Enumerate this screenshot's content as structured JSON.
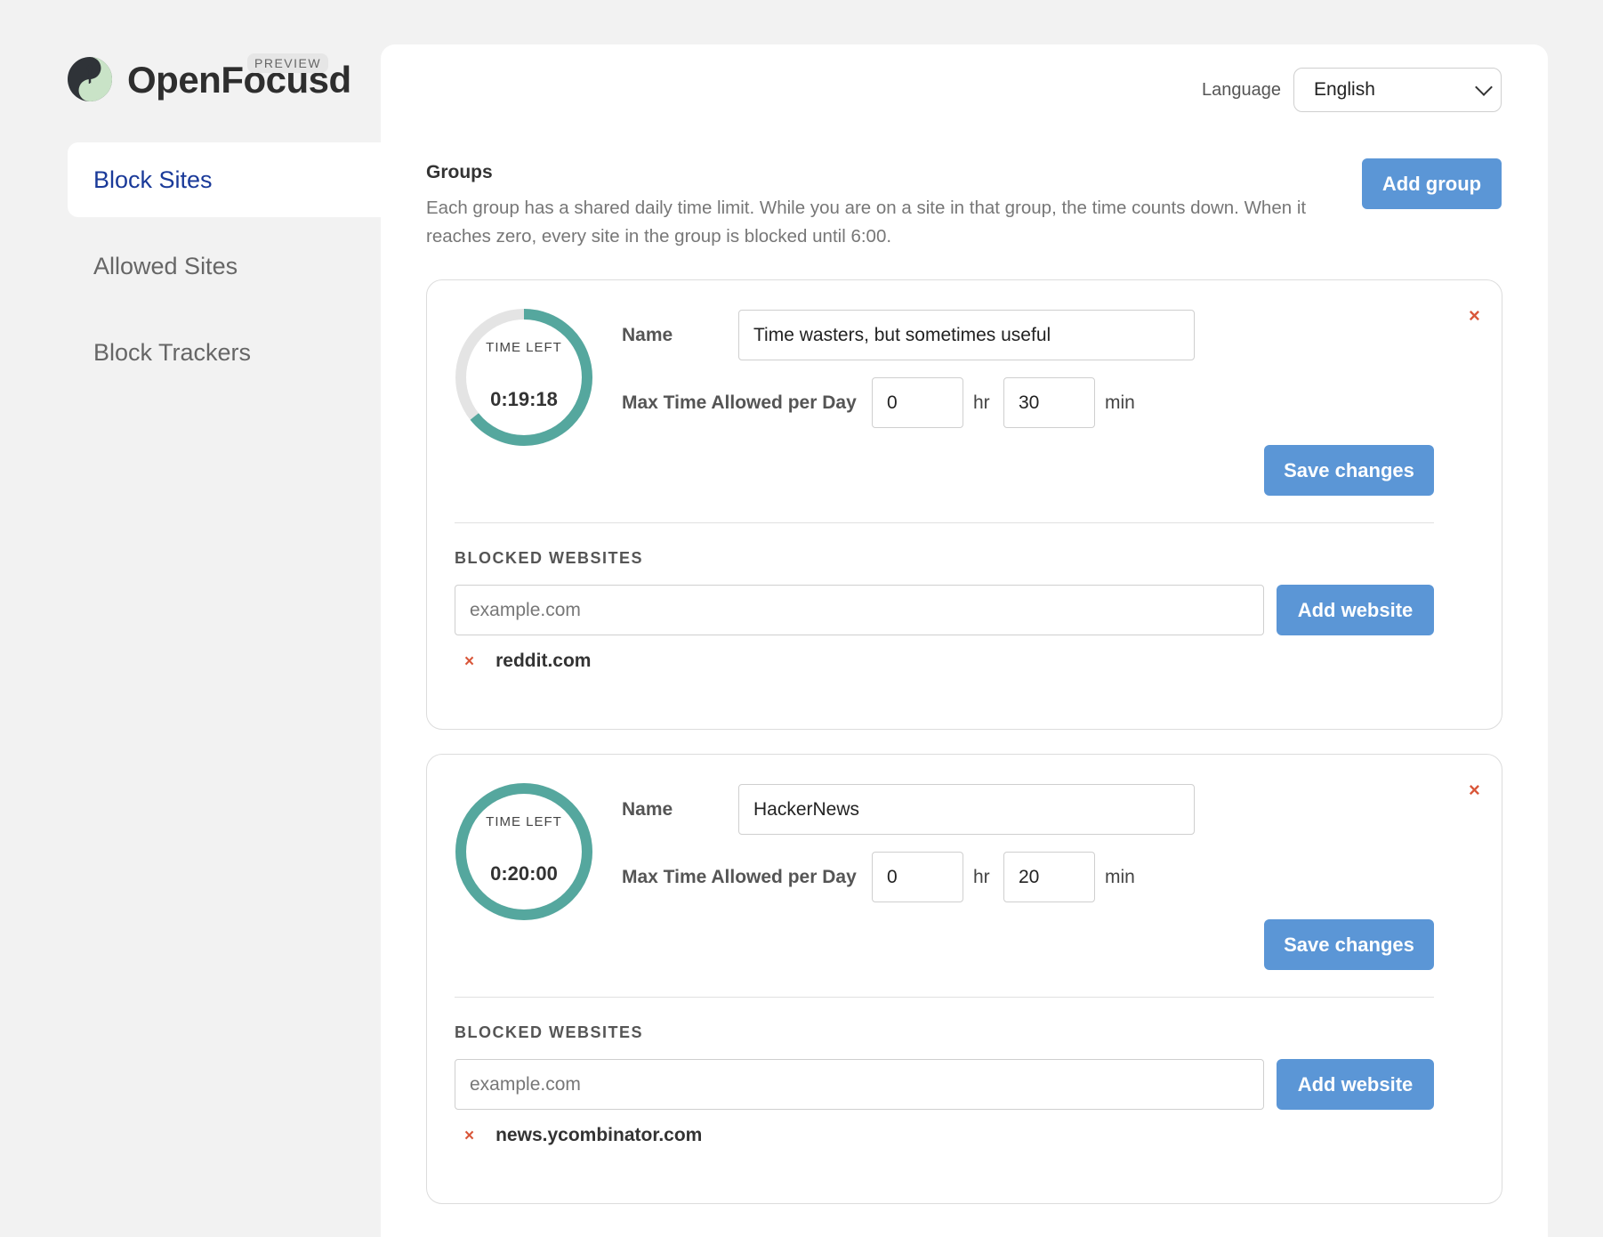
{
  "app": {
    "name": "OpenFocusd",
    "badge": "PREVIEW"
  },
  "sidebar": {
    "items": [
      {
        "label": "Block Sites",
        "active": true
      },
      {
        "label": "Allowed Sites",
        "active": false
      },
      {
        "label": "Block Trackers",
        "active": false
      }
    ]
  },
  "language": {
    "label": "Language",
    "selected": "English"
  },
  "groups": {
    "title": "Groups",
    "description": "Each group has a shared daily time limit. While you are on a site in that group, the time counts down. When it reaches zero, every site in the group is blocked until 6:00.",
    "add_group_label": "Add group",
    "list": [
      {
        "time_left_label": "TIME LEFT",
        "time_left": "0:19:18",
        "time_left_fraction": 0.6433,
        "name_label": "Name",
        "name_value": "Time wasters, but sometimes useful",
        "max_time_label": "Max Time Allowed per Day",
        "hours": "0",
        "hr_unit": "hr",
        "minutes": "30",
        "min_unit": "min",
        "save_label": "Save changes",
        "blocked_title": "BLOCKED WEBSITES",
        "site_placeholder": "example.com",
        "add_website_label": "Add website",
        "sites": [
          "reddit.com"
        ],
        "remove_icon": "×"
      },
      {
        "time_left_label": "TIME LEFT",
        "time_left": "0:20:00",
        "time_left_fraction": 1.0,
        "name_label": "Name",
        "name_value": "HackerNews",
        "max_time_label": "Max Time Allowed per Day",
        "hours": "0",
        "hr_unit": "hr",
        "minutes": "20",
        "min_unit": "min",
        "save_label": "Save changes",
        "blocked_title": "BLOCKED WEBSITES",
        "site_placeholder": "example.com",
        "add_website_label": "Add website",
        "sites": [
          "news.ycombinator.com"
        ],
        "remove_icon": "×"
      }
    ]
  },
  "colors": {
    "accent": "#5b96d6",
    "nav_active": "#1a3a99",
    "ring": "#55a79e",
    "ring_track": "#e4e4e4",
    "remove": "#d9573a"
  }
}
